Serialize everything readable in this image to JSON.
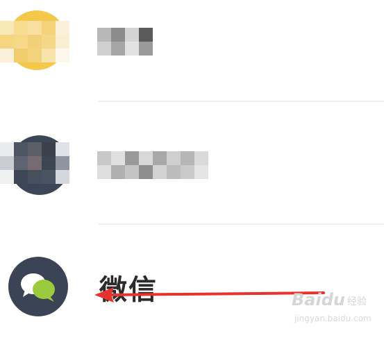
{
  "contacts": [
    {
      "name": "",
      "avatar_color": "#f4c84a",
      "redacted": true
    },
    {
      "name": "",
      "avatar_color": "#3c4656",
      "redacted": true
    },
    {
      "name": "微信",
      "avatar_color": "#3a4454",
      "redacted": false,
      "icon": "chat-bubbles-icon"
    }
  ],
  "colors": {
    "arrow": "#e8322e",
    "divider": "#eeeeee",
    "bubble_white": "#ffffff",
    "bubble_green": "#9bcb3c"
  },
  "watermark": {
    "brand": "Bai",
    "brand_suffix": "du",
    "sub": "经验",
    "url": "jingyan.baidu.com"
  }
}
